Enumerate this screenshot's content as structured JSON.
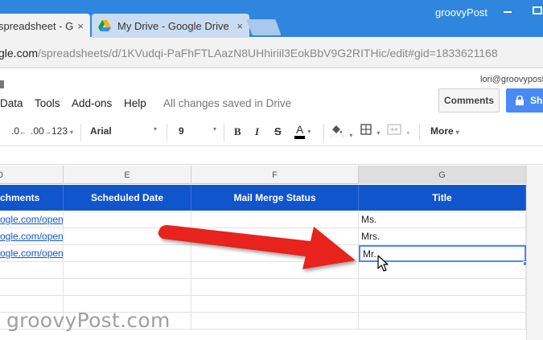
{
  "browser": {
    "tabs": [
      {
        "label": "spreadsheet - G"
      },
      {
        "label": "My Drive - Google Drive"
      }
    ],
    "close_glyph": "×",
    "profile_name": "groovyPost",
    "url_host": "gle.com",
    "url_path": "/spreadsheets/d/1KVudqi-PaFhFTLAazN8UHhiriil3EokBbV9G2RITHic/edit#gid=1833621168"
  },
  "sheets": {
    "menu": [
      "Data",
      "Tools",
      "Add-ons",
      "Help"
    ],
    "save_status": "All changes saved in Drive",
    "account": "lori@groovypost",
    "comments_label": "Comments",
    "share_label": "Sha",
    "toolbar": {
      "dec_decrease": ".0",
      "dec_increase": ".00",
      "format_123": "123",
      "font": "Arial",
      "font_size": "9",
      "bold": "B",
      "italic": "I",
      "strike": "S",
      "text_color": "A",
      "more": "More",
      "caret": "▾"
    }
  },
  "grid": {
    "columns": [
      {
        "letter": "D",
        "header": "chments"
      },
      {
        "letter": "E",
        "header": "Scheduled Date"
      },
      {
        "letter": "F",
        "header": "Mail Merge Status"
      },
      {
        "letter": "G",
        "header": "Title"
      }
    ],
    "rows": [
      {
        "d": "ogle.com/open",
        "e": "",
        "f": "",
        "g": "Ms."
      },
      {
        "d": "ogle.com/open",
        "e": "",
        "f": "",
        "g": "Mrs."
      },
      {
        "d": "ogle.com/open",
        "e": "",
        "f": "",
        "g": "Mr."
      }
    ],
    "header_color": "#1155cc",
    "selection_color": "#4a8af4"
  },
  "annotation": {
    "arrow_color": "#e8231f"
  },
  "watermark": "groovyPost.com"
}
